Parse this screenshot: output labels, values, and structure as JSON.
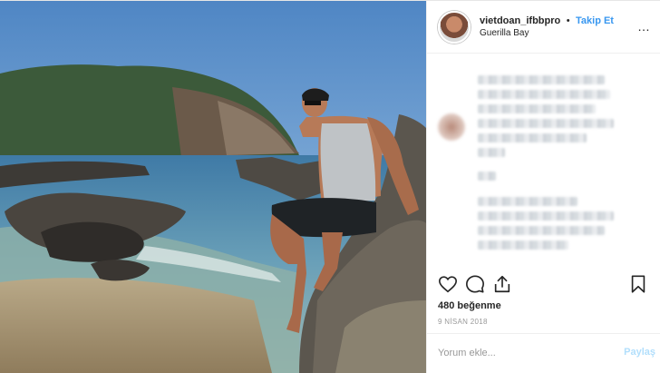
{
  "post": {
    "username": "vietdoan_ifbbpro",
    "separator": "•",
    "follow_label": "Takip Et",
    "location": "Guerilla Bay",
    "more_label": "…",
    "likes": "480 beğenme",
    "date": "9 NİSAN 2018",
    "comment_placeholder": "Yorum ekle...",
    "post_button": "Paylaş"
  },
  "icons": {
    "like": "heart-icon",
    "comment": "comment-icon",
    "share": "share-icon",
    "save": "bookmark-icon",
    "more": "more-options-icon"
  },
  "colors": {
    "accent": "#3897f0",
    "text": "#262626",
    "muted": "#999999",
    "post_disabled": "#b2dffc"
  }
}
